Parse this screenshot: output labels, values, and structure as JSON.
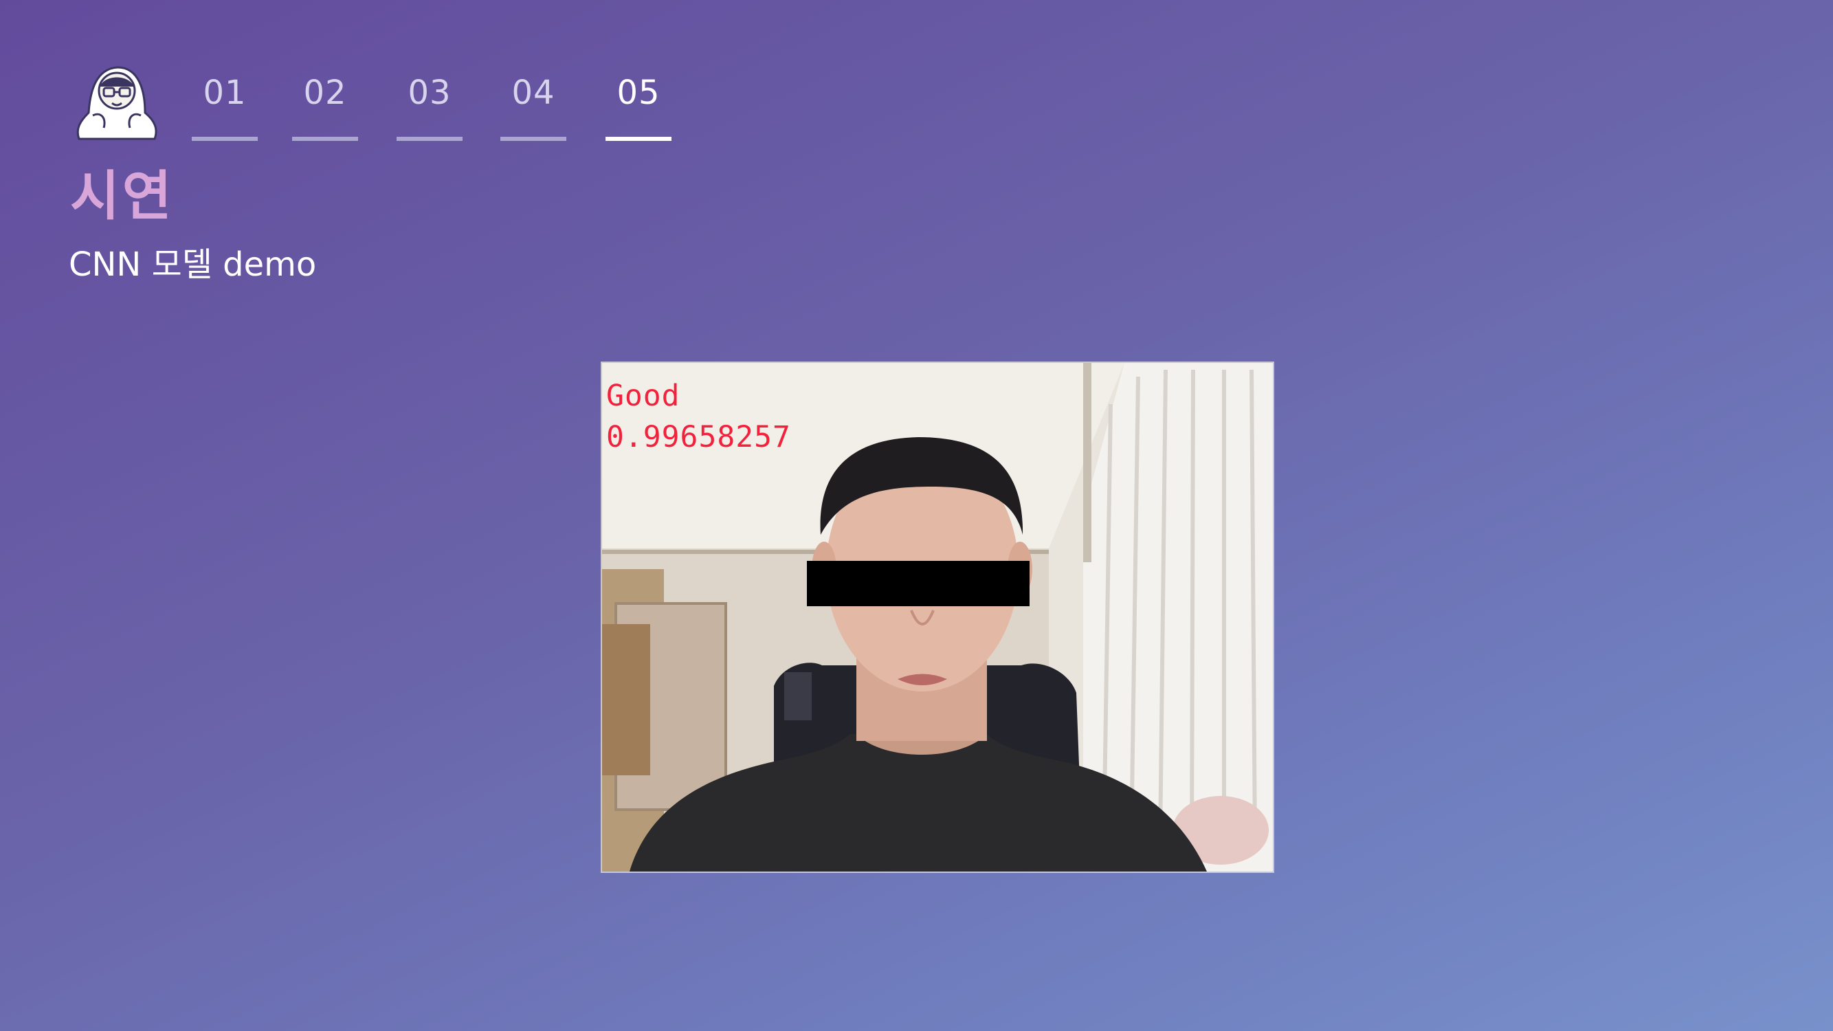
{
  "header": {
    "tabs": [
      {
        "label": "01",
        "active": false
      },
      {
        "label": "02",
        "active": false
      },
      {
        "label": "03",
        "active": false
      },
      {
        "label": "04",
        "active": false
      },
      {
        "label": "05",
        "active": true
      }
    ],
    "section_title": "시연",
    "section_subtitle": "CNN 모델 demo"
  },
  "webcam": {
    "prediction_label": "Good",
    "prediction_score": "0.99658257",
    "overlay_color": "#f2213c"
  },
  "colors": {
    "background_start": "#634b9c",
    "background_end": "#7891cb",
    "title_accent": "#d9a6d9",
    "active_tab": "#ffffff",
    "inactive_tab": "#aaa6cf"
  },
  "icons": {
    "avatar": "cartoon-character-in-blanket-icon"
  }
}
